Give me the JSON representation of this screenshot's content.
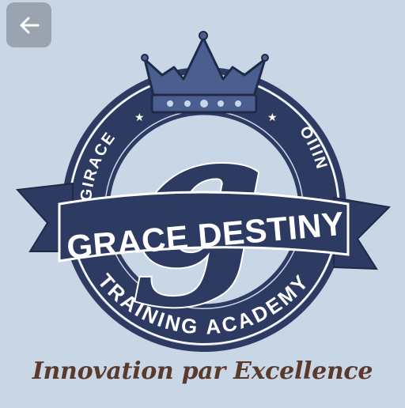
{
  "nav": {
    "back_icon": "arrow-left-icon"
  },
  "logo": {
    "monogram": "g",
    "banner_text": "GRACE DESTINY",
    "ring_top_left": "GIRACE",
    "ring_top_right": "OIIIN",
    "ring_bottom": "TRAINING ACADEMY",
    "emblem_icon": "crown-icon",
    "star_icon": "star-icon"
  },
  "tagline": "Innovation par Excellence",
  "colors": {
    "background": "#c9d6e6",
    "navy": "#2d3b63",
    "crown": "#4a5f8f",
    "tagline": "#5a3a2c"
  }
}
